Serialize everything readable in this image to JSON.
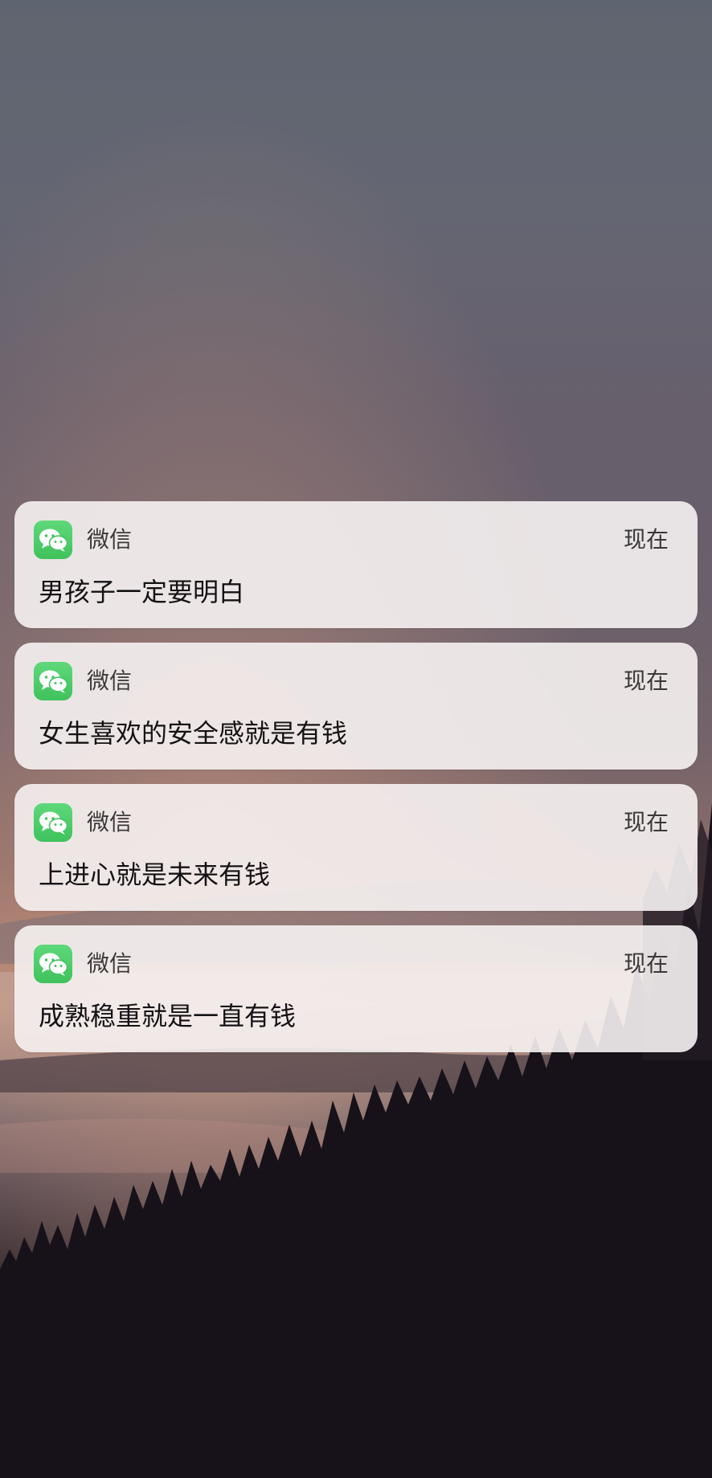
{
  "notifications": [
    {
      "app": "微信",
      "time": "现在",
      "message": "男孩子一定要明白",
      "icon": "wechat-icon"
    },
    {
      "app": "微信",
      "time": "现在",
      "message": "女生喜欢的安全感就是有钱",
      "icon": "wechat-icon"
    },
    {
      "app": "微信",
      "time": "现在",
      "message": "上进心就是未来有钱",
      "icon": "wechat-icon"
    },
    {
      "app": "微信",
      "time": "现在",
      "message": "成熟稳重就是一直有钱",
      "icon": "wechat-icon"
    }
  ],
  "colors": {
    "wechat_green": "#4ccb68",
    "card_background": "#f4f0f0",
    "message_text": "#141214",
    "meta_text": "#3a3838"
  }
}
